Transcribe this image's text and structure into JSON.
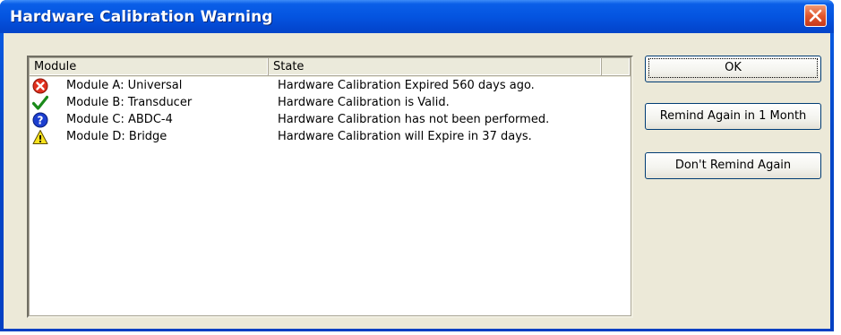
{
  "window": {
    "title": "Hardware Calibration Warning"
  },
  "list": {
    "columns": [
      "Module",
      "State"
    ],
    "rows": [
      {
        "icon": "error-icon",
        "module": "Module A: Universal",
        "state": "Hardware Calibration Expired 560 days ago."
      },
      {
        "icon": "check-icon",
        "module": "Module B: Transducer",
        "state": "Hardware Calibration is Valid."
      },
      {
        "icon": "question-icon",
        "module": "Module C: ABDC-4",
        "state": "Hardware Calibration has not been performed."
      },
      {
        "icon": "warning-icon",
        "module": "Module D: Bridge",
        "state": "Hardware Calibration will Expire in 37 days."
      }
    ]
  },
  "buttons": {
    "ok": "OK",
    "remind": "Remind Again in 1 Month",
    "dont": "Don't Remind Again"
  },
  "colors": {
    "title_bar": "#0454e0",
    "dialog_bg": "#ece9d8",
    "close_button": "#e1572d"
  }
}
